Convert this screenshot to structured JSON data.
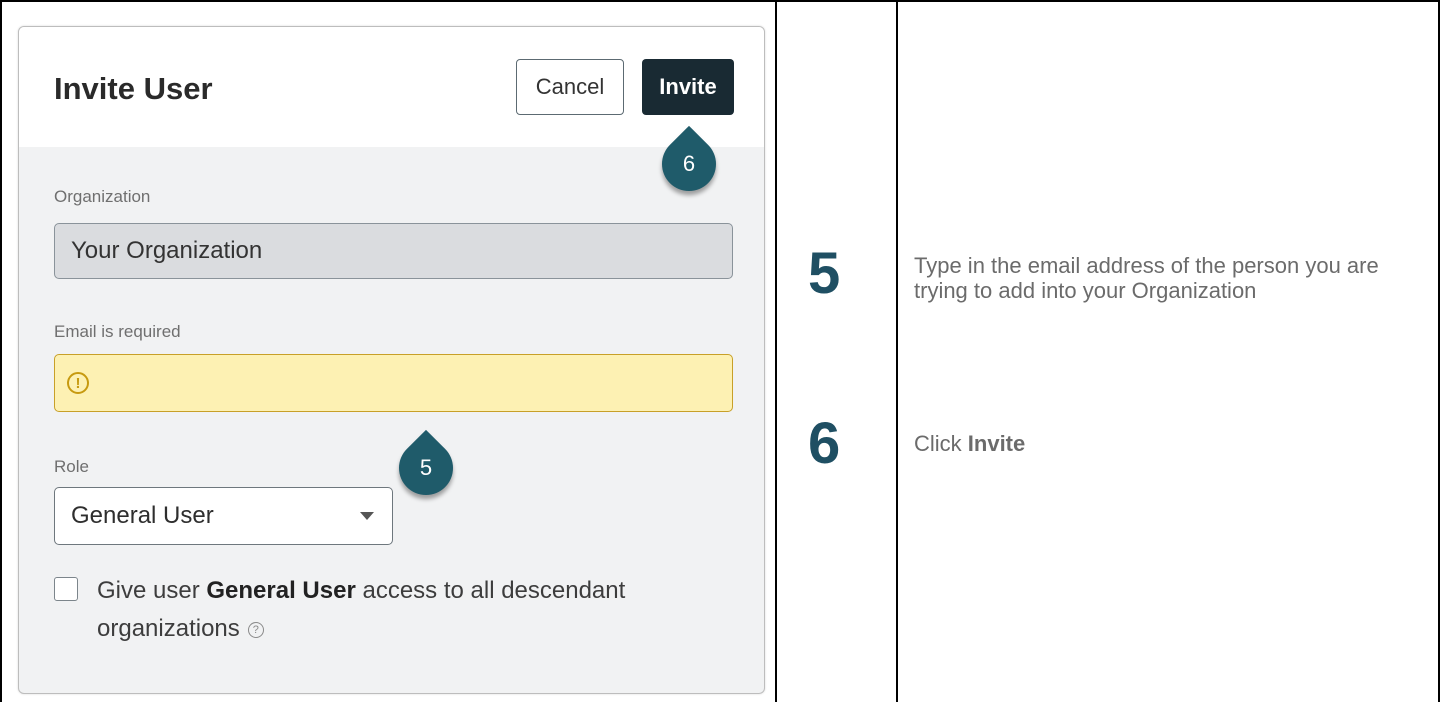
{
  "dialog": {
    "title": "Invite User",
    "cancel_label": "Cancel",
    "invite_label": "Invite",
    "organization": {
      "label": "Organization",
      "value": "Your Organization"
    },
    "email": {
      "label": "Email is required",
      "value": "",
      "warning_icon": "exclamation-circle-icon"
    },
    "role": {
      "label": "Role",
      "selected": "General User"
    },
    "descendant_access": {
      "text_before": "Give user ",
      "role_bold": "General User",
      "text_after": " access to all descendant organizations",
      "checked": false,
      "help_icon": "question-circle-icon"
    }
  },
  "callouts": [
    {
      "number": "6"
    },
    {
      "number": "5"
    }
  ],
  "steps": [
    {
      "number": "5",
      "text": "Type in the email address of the person you are trying to add into your Organization"
    },
    {
      "number": "6",
      "text_before": "Click ",
      "text_bold": "Invite"
    }
  ],
  "colors": {
    "accent": "#1f5b6a",
    "invite_button": "#192a33",
    "warning_bg": "#fdf1b3",
    "warning_border": "#c8a028"
  }
}
